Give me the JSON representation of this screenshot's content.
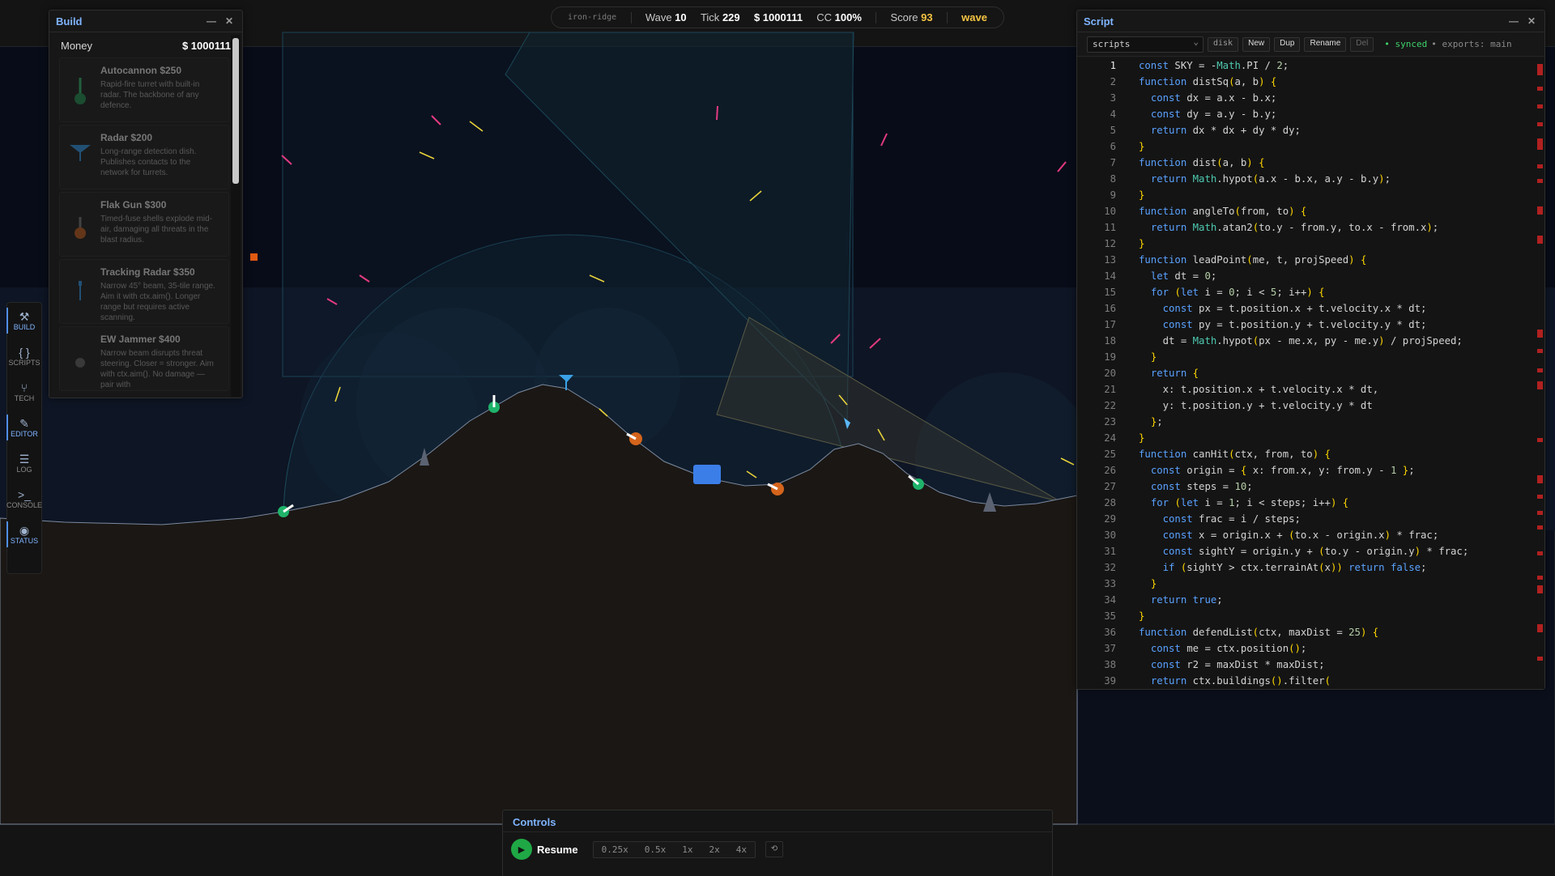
{
  "hud": {
    "map": "iron-ridge",
    "wave_label": "Wave",
    "wave": "10",
    "tick_label": "Tick",
    "tick": "229",
    "money": "$ 1000111",
    "cc_label": "CC",
    "cc": "100%",
    "score_label": "Score",
    "score": "93",
    "phase": "wave"
  },
  "build": {
    "title": "Build",
    "money_label": "Money",
    "money": "$ 1000111",
    "items": [
      {
        "name": "Autocannon $250",
        "desc": "Rapid-fire turret with built-in radar. The backbone of any defence.",
        "icon": "autocannon-icon"
      },
      {
        "name": "Radar $200",
        "desc": "Long-range detection dish. Publishes contacts to the network for turrets.",
        "icon": "radar-icon"
      },
      {
        "name": "Flak Gun $300",
        "desc": "Timed-fuse shells explode mid-air, damaging all threats in the blast radius.",
        "icon": "flak-gun-icon"
      },
      {
        "name": "Tracking Radar $350",
        "desc": "Narrow 45° beam, 35-tile range. Aim it with ctx.aim(). Longer range but requires active scanning.",
        "icon": "tracking-radar-icon"
      },
      {
        "name": "EW Jammer $400",
        "desc": "Narrow beam disrupts threat steering. Closer = stronger. Aim with ctx.aim(). No damage — pair with",
        "icon": "jammer-icon"
      }
    ]
  },
  "sidebar": [
    {
      "label": "BUILD",
      "icon": "hammer-icon",
      "glyph": "⚒"
    },
    {
      "label": "SCRIPTS",
      "icon": "braces-icon",
      "glyph": "{ }"
    },
    {
      "label": "TECH",
      "icon": "tech-icon",
      "glyph": "⑂"
    },
    {
      "label": "EDITOR",
      "icon": "pencil-icon",
      "glyph": "✎"
    },
    {
      "label": "LOG",
      "icon": "list-icon",
      "glyph": "☰"
    },
    {
      "label": "CONSOLE",
      "icon": "terminal-icon",
      "glyph": ">_"
    },
    {
      "label": "STATUS",
      "icon": "eye-icon",
      "glyph": "◉"
    }
  ],
  "script": {
    "title": "Script",
    "select": "scripts",
    "disk": "disk",
    "new": "New",
    "dup": "Dup",
    "rename": "Rename",
    "del": "Del",
    "synced": "• synced",
    "exports": "• exports: main",
    "lines": [
      "const SKY = -Math.PI / 2;",
      "function distSq(a, b) {",
      "  const dx = a.x - b.x;",
      "  const dy = a.y - b.y;",
      "  return dx * dx + dy * dy;",
      "}",
      "function dist(a, b) {",
      "  return Math.hypot(a.x - b.x, a.y - b.y);",
      "}",
      "function angleTo(from, to) {",
      "  return Math.atan2(to.y - from.y, to.x - from.x);",
      "}",
      "function leadPoint(me, t, projSpeed) {",
      "  let dt = 0;",
      "  for (let i = 0; i < 5; i++) {",
      "    const px = t.position.x + t.velocity.x * dt;",
      "    const py = t.position.y + t.velocity.y * dt;",
      "    dt = Math.hypot(px - me.x, py - me.y) / projSpeed;",
      "  }",
      "  return {",
      "    x: t.position.x + t.velocity.x * dt,",
      "    y: t.position.y + t.velocity.y * dt",
      "  };",
      "}",
      "function canHit(ctx, from, to) {",
      "  const origin = { x: from.x, y: from.y - 1 };",
      "  const steps = 10;",
      "  for (let i = 1; i < steps; i++) {",
      "    const frac = i / steps;",
      "    const x = origin.x + (to.x - origin.x) * frac;",
      "    const sightY = origin.y + (to.y - origin.y) * frac;",
      "    if (sightY > ctx.terrainAt(x)) return false;",
      "  }",
      "  return true;",
      "}",
      "function defendList(ctx, maxDist = 25) {",
      "  const me = ctx.position();",
      "  const r2 = maxDist * maxDist;",
      "  return ctx.buildings().filter("
    ]
  },
  "controls": {
    "title": "Controls",
    "resume": "Resume",
    "speeds": [
      "0.25x",
      "0.5x",
      "1x",
      "2x",
      "4x"
    ],
    "reset": "⟲"
  }
}
